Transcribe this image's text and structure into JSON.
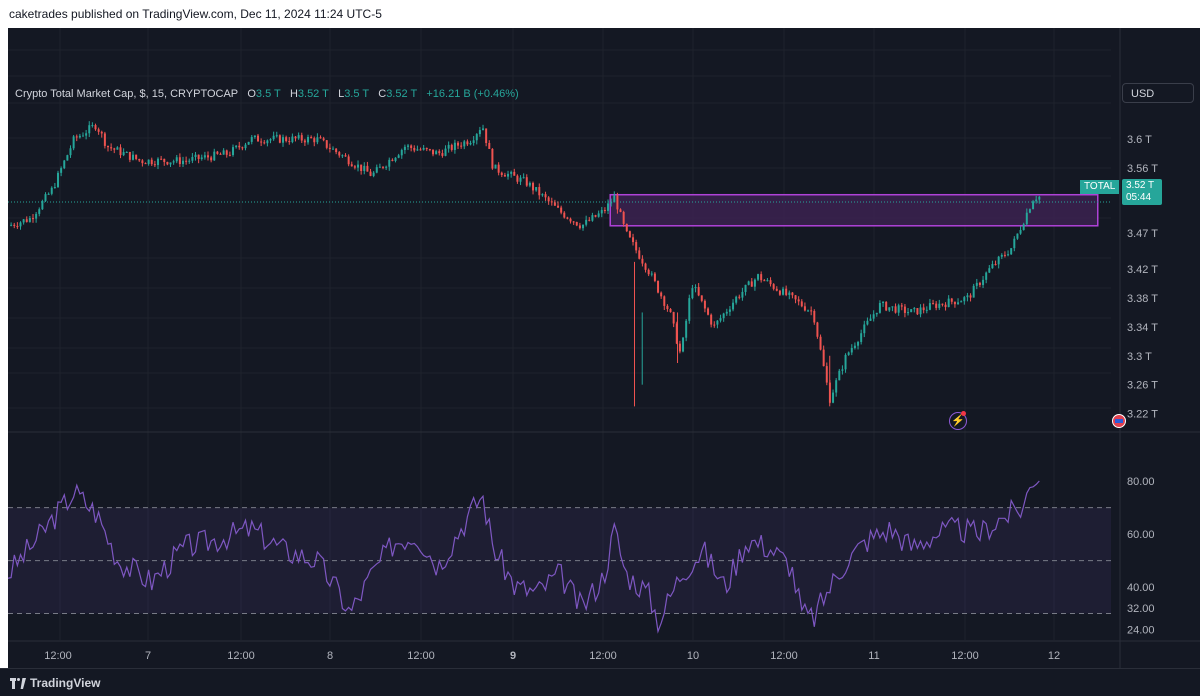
{
  "header": {
    "publish_line": "caketrades published on TradingView.com, Dec 11, 2024 11:24 UTC-5"
  },
  "legend": {
    "symbol": "Crypto Total Market Cap, $, 15, CRYPTOCAP",
    "o_label": "O",
    "o_value": "3.5 T",
    "h_label": "H",
    "h_value": "3.52 T",
    "l_label": "L",
    "l_value": "3.5 T",
    "c_label": "C",
    "c_value": "3.52 T",
    "change": "+16.21 B (+0.46%)"
  },
  "currency_button": "USD",
  "price_axis_labels": [
    "3.6 T",
    "3.56 T",
    "3.47 T",
    "3.42 T",
    "3.38 T",
    "3.34 T",
    "3.3 T",
    "3.26 T",
    "3.22 T"
  ],
  "last_price_tag": {
    "symbol": "TOTAL",
    "price": "3.52 T",
    "countdown": "05:44"
  },
  "rsi_axis_labels": [
    "80.00",
    "60.00",
    "40.00",
    "32.00",
    "24.00"
  ],
  "time_axis_labels": [
    "12:00",
    "7",
    "12:00",
    "8",
    "12:00",
    "9",
    "12:00",
    "10",
    "12:00",
    "11",
    "12:00",
    "12"
  ],
  "footer": {
    "brand": "TradingView"
  },
  "colors": {
    "background": "#141823",
    "up": "#26a69a",
    "down": "#ef5350",
    "rsi_line": "#7e57c2",
    "zone_border": "#b042d8",
    "zone_fill": "#3b2250"
  },
  "chart_data": {
    "type": "candlestick",
    "price_unit": "T USD",
    "timeframe": "15",
    "price_ylim": [
      3.2,
      3.65
    ],
    "close_path": [
      [
        0.0,
        3.48
      ],
      [
        0.02,
        3.49
      ],
      [
        0.04,
        3.53
      ],
      [
        0.06,
        3.6
      ],
      [
        0.08,
        3.62
      ],
      [
        0.09,
        3.59
      ],
      [
        0.12,
        3.57
      ],
      [
        0.16,
        3.57
      ],
      [
        0.2,
        3.58
      ],
      [
        0.22,
        3.6
      ],
      [
        0.25,
        3.6
      ],
      [
        0.28,
        3.6
      ],
      [
        0.3,
        3.58
      ],
      [
        0.33,
        3.55
      ],
      [
        0.36,
        3.59
      ],
      [
        0.39,
        3.58
      ],
      [
        0.42,
        3.6
      ],
      [
        0.43,
        3.62
      ],
      [
        0.44,
        3.56
      ],
      [
        0.47,
        3.54
      ],
      [
        0.5,
        3.5
      ],
      [
        0.52,
        3.48
      ],
      [
        0.54,
        3.5
      ],
      [
        0.55,
        3.52
      ],
      [
        0.56,
        3.47
      ],
      [
        0.58,
        3.42
      ],
      [
        0.6,
        3.36
      ],
      [
        0.61,
        3.3
      ],
      [
        0.62,
        3.4
      ],
      [
        0.64,
        3.34
      ],
      [
        0.66,
        3.38
      ],
      [
        0.68,
        3.41
      ],
      [
        0.7,
        3.39
      ],
      [
        0.72,
        3.37
      ],
      [
        0.73,
        3.36
      ],
      [
        0.745,
        3.24
      ],
      [
        0.76,
        3.3
      ],
      [
        0.79,
        3.37
      ],
      [
        0.82,
        3.36
      ],
      [
        0.84,
        3.37
      ],
      [
        0.87,
        3.38
      ],
      [
        0.89,
        3.42
      ],
      [
        0.91,
        3.45
      ],
      [
        0.93,
        3.52
      ]
    ],
    "rsi_ylim": [
      20,
      88
    ],
    "rsi_levels": [
      70,
      50,
      30
    ],
    "rsi_path": [
      [
        0.0,
        45
      ],
      [
        0.03,
        60
      ],
      [
        0.06,
        76
      ],
      [
        0.08,
        68
      ],
      [
        0.1,
        50
      ],
      [
        0.13,
        42
      ],
      [
        0.16,
        55
      ],
      [
        0.19,
        58
      ],
      [
        0.22,
        62
      ],
      [
        0.25,
        54
      ],
      [
        0.28,
        50
      ],
      [
        0.3,
        38
      ],
      [
        0.31,
        30
      ],
      [
        0.33,
        45
      ],
      [
        0.35,
        57
      ],
      [
        0.37,
        60
      ],
      [
        0.39,
        48
      ],
      [
        0.41,
        62
      ],
      [
        0.43,
        75
      ],
      [
        0.44,
        55
      ],
      [
        0.46,
        40
      ],
      [
        0.48,
        38
      ],
      [
        0.5,
        45
      ],
      [
        0.52,
        32
      ],
      [
        0.54,
        44
      ],
      [
        0.55,
        62
      ],
      [
        0.56,
        45
      ],
      [
        0.58,
        38
      ],
      [
        0.59,
        27
      ],
      [
        0.61,
        45
      ],
      [
        0.63,
        54
      ],
      [
        0.65,
        40
      ],
      [
        0.67,
        58
      ],
      [
        0.69,
        55
      ],
      [
        0.71,
        48
      ],
      [
        0.72,
        30
      ],
      [
        0.73,
        28
      ],
      [
        0.745,
        40
      ],
      [
        0.76,
        50
      ],
      [
        0.78,
        58
      ],
      [
        0.8,
        62
      ],
      [
        0.82,
        55
      ],
      [
        0.84,
        60
      ],
      [
        0.86,
        62
      ],
      [
        0.88,
        60
      ],
      [
        0.9,
        66
      ],
      [
        0.92,
        70
      ],
      [
        0.93,
        82
      ]
    ],
    "zone": {
      "x_start": 0.546,
      "x_end": 0.988,
      "y_low": 3.48,
      "y_high": 3.523
    }
  }
}
